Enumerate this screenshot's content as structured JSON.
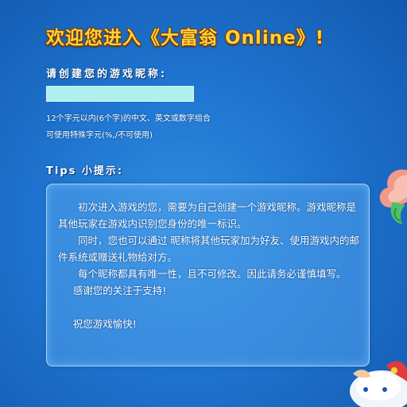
{
  "header": {
    "welcome_title": "欢迎您进入《大富翁 Online》!"
  },
  "form": {
    "prompt_label": "请创建您的游戏昵称:",
    "nickname_value": "",
    "hint_line1": "12个字元以内(6个字)的中文、英文或数字组合",
    "hint_line2": "可使用特殊字元(%,/不可使用)"
  },
  "tips": {
    "title": "Tips 小提示:",
    "paragraphs": [
      "初次进入游戏的您，需要为自己创建一个游戏昵称。游戏昵称是其他玩家在游戏内识别您身份的唯一标识。",
      "同时，您也可以通过 昵称将其他玩家加为好友、使用游戏内的邮件系统或赠送礼物给对方。",
      "每个昵称都具有唯一性，且不可修改。因此请务必谨慎填写。",
      "感谢您的关注于支持!",
      "祝您游戏愉快!"
    ]
  },
  "colors": {
    "background": "#1f74cf",
    "title_gold": "#ffd23a",
    "input_fill": "#aef0ee"
  }
}
